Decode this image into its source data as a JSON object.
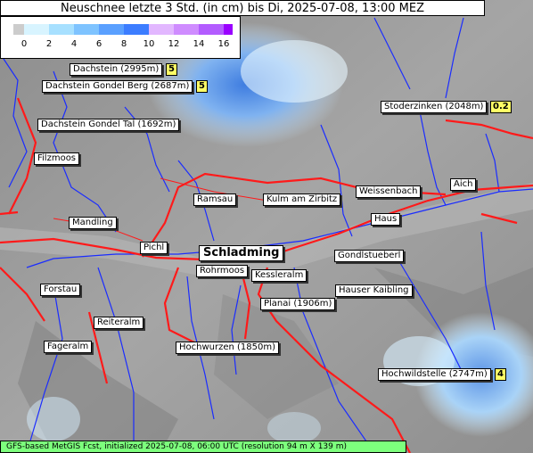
{
  "title": "Neuschnee letzte 3 Std. (in cm) bis Di, 2025-07-08, 13:00 MEZ",
  "legend": {
    "ticks": [
      "0",
      "2",
      "4",
      "6",
      "8",
      "10",
      "12",
      "14",
      "16"
    ],
    "colors": [
      "#cccccc",
      "#d8f4ff",
      "#a7e0ff",
      "#7ec3ff",
      "#5aa0ff",
      "#3c7dff",
      "#e2b7ff",
      "#cf8cff",
      "#b35cff",
      "#9a00ff"
    ]
  },
  "locations": [
    {
      "name": "Dachstein (2995m)",
      "value": "5"
    },
    {
      "name": "Dachstein Gondel Berg (2687m)",
      "value": "5"
    },
    {
      "name": "Stoderzinken (2048m)",
      "value": "0.2"
    },
    {
      "name": "Dachstein Gondel Tal (1692m)"
    },
    {
      "name": "Filzmoos"
    },
    {
      "name": "Ramsau"
    },
    {
      "name": "Kulm am Zirbitz"
    },
    {
      "name": "Weissenbach"
    },
    {
      "name": "Aich"
    },
    {
      "name": "Mandling"
    },
    {
      "name": "Haus"
    },
    {
      "name": "Pichl"
    },
    {
      "name": "Schladming"
    },
    {
      "name": "Gondlstueberl"
    },
    {
      "name": "Rohrmoos"
    },
    {
      "name": "Kessleralm"
    },
    {
      "name": "Forstau"
    },
    {
      "name": "Hauser Kaibling"
    },
    {
      "name": "Planai (1906m)"
    },
    {
      "name": "Reiteralm"
    },
    {
      "name": "Fageralm"
    },
    {
      "name": "Hochwurzen (1850m)"
    },
    {
      "name": "Hochwildstelle (2747m)",
      "value": "4"
    }
  ],
  "footer": "GFS-based MetGIS Fcst, initialized 2025-07-08, 06:00 UTC  (resolution 94 m X 139 m)"
}
